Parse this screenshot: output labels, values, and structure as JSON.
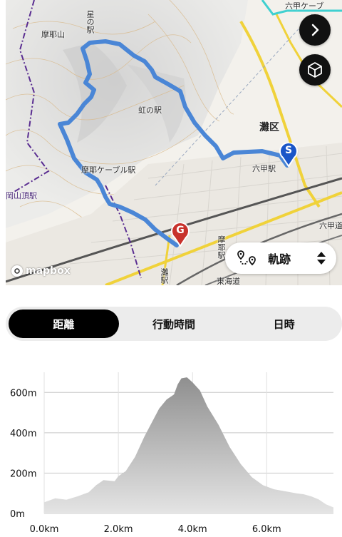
{
  "map": {
    "labels": {
      "maya_san": "摩耶山",
      "hoshi_no_eki": "星の駅",
      "niji_no_eki": "虹の駅",
      "maya_cable": "摩耶ケーブル駅",
      "nada_ku": "灘区",
      "rokko_station": "六甲駅",
      "rokko_cable": "六甲ケーブ",
      "rokko_michi": "六甲道",
      "okayama_station": "岡山頂駅",
      "maya_station": "摩耶駅",
      "nada_station": "灘駅",
      "tokaido": "東海道"
    },
    "start_marker": "S",
    "goal_marker": "G",
    "forward_button_icon": "chevron-right-icon",
    "view3d_button_icon": "cube-icon",
    "attribution": "mapbox",
    "layer_selector": {
      "label": "軌跡",
      "icon": "route-icon",
      "toggle_icon": "up-down-icon"
    },
    "colors": {
      "track": "#4a86d6",
      "start": "#1a56c8",
      "goal": "#c8322c"
    }
  },
  "tabs": [
    {
      "label": "距離",
      "active": true
    },
    {
      "label": "行動時間",
      "active": false
    },
    {
      "label": "日時",
      "active": false
    }
  ],
  "chart_data": {
    "type": "area",
    "title": "",
    "xlabel": "",
    "ylabel": "",
    "x_unit": "km",
    "y_unit": "m",
    "xlim": [
      0,
      7.8
    ],
    "ylim": [
      0,
      700
    ],
    "yticks": [
      "0m",
      "200m",
      "400m",
      "600m"
    ],
    "xticks": [
      "0.0km",
      "2.0km",
      "4.0km",
      "6.0km"
    ],
    "grid": true,
    "series": [
      {
        "x": [
          0,
          0.3,
          0.6,
          0.9,
          1.2,
          1.4,
          1.6,
          1.9,
          2.0,
          2.2,
          2.45,
          2.7,
          2.9,
          3.1,
          3.3,
          3.5,
          3.6,
          3.7,
          3.85,
          4.0,
          4.2,
          4.4,
          4.7,
          5.0,
          5.3,
          5.6,
          5.9,
          6.2,
          6.5,
          6.8,
          7.0,
          7.2,
          7.4,
          7.6,
          7.8
        ],
        "y": [
          55,
          75,
          68,
          85,
          105,
          140,
          165,
          160,
          185,
          210,
          280,
          380,
          450,
          520,
          565,
          590,
          640,
          670,
          675,
          650,
          610,
          530,
          440,
          330,
          245,
          180,
          140,
          120,
          110,
          100,
          95,
          85,
          70,
          45,
          30
        ]
      }
    ]
  }
}
